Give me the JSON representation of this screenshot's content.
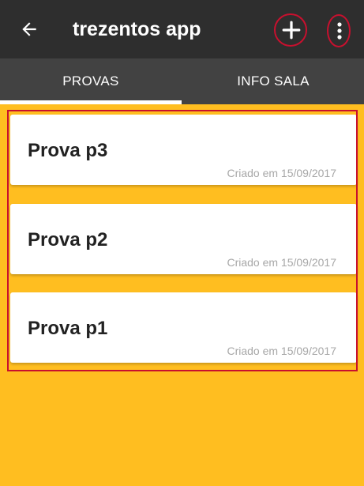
{
  "app_bar": {
    "title": "trezentos app",
    "back_icon": "arrow-left-icon",
    "add_icon": "plus-icon",
    "menu_icon": "more-vert-icon"
  },
  "tabs": [
    {
      "label": "PROVAS",
      "selected": true
    },
    {
      "label": "INFO SALA",
      "selected": false
    }
  ],
  "provas": [
    {
      "title": "Prova p3",
      "created": "Criado em 15/09/2017"
    },
    {
      "title": "Prova p2",
      "created": "Criado em 15/09/2017"
    },
    {
      "title": "Prova p1",
      "created": "Criado em 15/09/2017"
    }
  ],
  "colors": {
    "app_bar": "#2E2E2E",
    "tab_bar": "#424242",
    "background": "#FFBE20",
    "annotation": "#C8102E",
    "date_text": "#A7A7A7"
  }
}
